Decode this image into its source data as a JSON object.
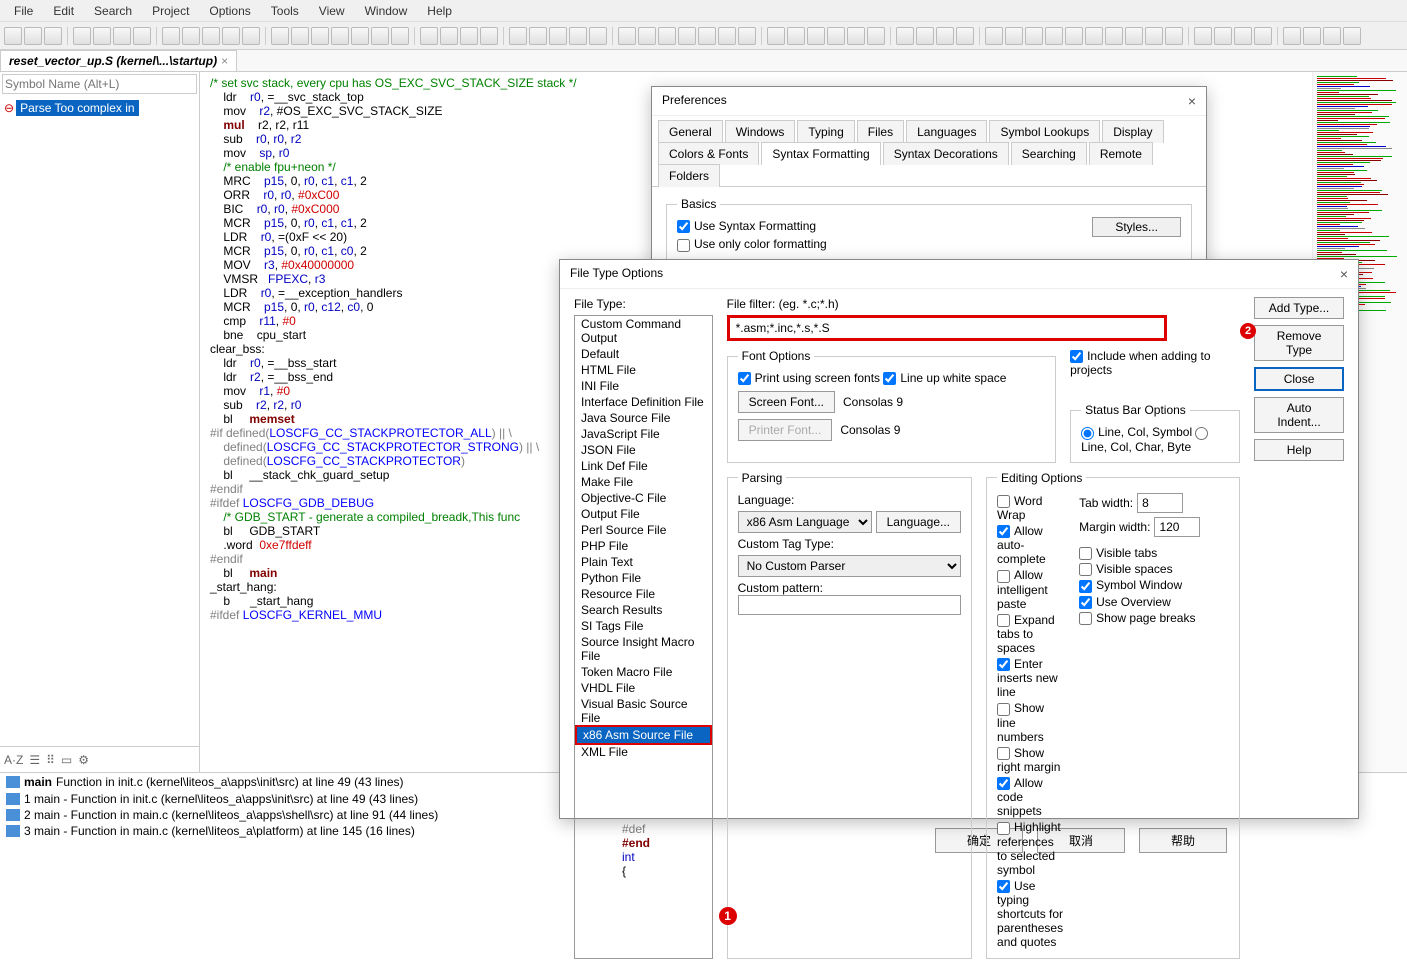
{
  "menu": [
    "File",
    "Edit",
    "Search",
    "Project",
    "Options",
    "Tools",
    "View",
    "Window",
    "Help"
  ],
  "tab": {
    "label": "reset_vector_up.S (kernel\\...\\startup)"
  },
  "sidebar": {
    "placeholder": "Symbol Name (Alt+L)",
    "item": "Parse Too complex in"
  },
  "code": [
    {
      "t": "c",
      "v": "/* set svc stack, every cpu has OS_EXC_SVC_STACK_SIZE stack */"
    },
    {
      "t": "",
      "v": "    ldr    r0, =__svc_stack_top"
    },
    {
      "t": "",
      "v": "    mov    r2, #OS_EXC_SVC_STACK_SIZE"
    },
    {
      "t": "kw",
      "v": "    mul    r2, r2, r11"
    },
    {
      "t": "",
      "v": "    sub    r0, r0, r2"
    },
    {
      "t": "",
      "v": "    mov    sp, r0"
    },
    {
      "t": "",
      "v": ""
    },
    {
      "t": "c",
      "v": "    /* enable fpu+neon */"
    },
    {
      "t": "",
      "v": "    MRC    p15, 0, r0, c1, c1, 2"
    },
    {
      "t": "",
      "v": "    ORR    r0, r0, #0xC00"
    },
    {
      "t": "",
      "v": "    BIC    r0, r0, #0xC000"
    },
    {
      "t": "",
      "v": "    MCR    p15, 0, r0, c1, c1, 2"
    },
    {
      "t": "",
      "v": ""
    },
    {
      "t": "",
      "v": "    LDR    r0, =(0xF << 20)"
    },
    {
      "t": "",
      "v": "    MCR    p15, 0, r0, c1, c0, 2"
    },
    {
      "t": "",
      "v": ""
    },
    {
      "t": "",
      "v": "    MOV    r3, #0x40000000"
    },
    {
      "t": "",
      "v": "    VMSR   FPEXC, r3"
    },
    {
      "t": "",
      "v": ""
    },
    {
      "t": "",
      "v": "    LDR    r0, =__exception_handlers"
    },
    {
      "t": "",
      "v": "    MCR    p15, 0, r0, c12, c0, 0"
    },
    {
      "t": "",
      "v": ""
    },
    {
      "t": "",
      "v": "    cmp    r11, #0"
    },
    {
      "t": "",
      "v": "    bne    cpu_start"
    },
    {
      "t": "",
      "v": ""
    },
    {
      "t": "l",
      "v": "clear_bss:"
    },
    {
      "t": "",
      "v": "    ldr    r0, =__bss_start"
    },
    {
      "t": "",
      "v": "    ldr    r2, =__bss_end"
    },
    {
      "t": "",
      "v": "    mov    r1, #0"
    },
    {
      "t": "",
      "v": "    sub    r2, r2, r0"
    },
    {
      "t": "kw",
      "v": "    bl     memset"
    },
    {
      "t": "",
      "v": ""
    },
    {
      "t": "p",
      "v": "#if defined(LOSCFG_CC_STACKPROTECTOR_ALL) || \\"
    },
    {
      "t": "p",
      "v": "    defined(LOSCFG_CC_STACKPROTECTOR_STRONG) || \\"
    },
    {
      "t": "p",
      "v": "    defined(LOSCFG_CC_STACKPROTECTOR)"
    },
    {
      "t": "",
      "v": "    bl     __stack_chk_guard_setup"
    },
    {
      "t": "p",
      "v": "#endif"
    },
    {
      "t": "",
      "v": ""
    },
    {
      "t": "p",
      "v": "#ifdef LOSCFG_GDB_DEBUG"
    },
    {
      "t": "c",
      "v": "    /* GDB_START - generate a compiled_breadk,This func"
    },
    {
      "t": "",
      "v": "    bl     GDB_START"
    },
    {
      "t": "n",
      "v": "    .word  0xe7ffdeff"
    },
    {
      "t": "p",
      "v": "#endif"
    },
    {
      "t": "",
      "v": ""
    },
    {
      "t": "kw",
      "v": "    bl     main"
    },
    {
      "t": "",
      "v": ""
    },
    {
      "t": "l",
      "v": "_start_hang:"
    },
    {
      "t": "",
      "v": "    b      _start_hang"
    },
    {
      "t": "",
      "v": ""
    },
    {
      "t": "p",
      "v": "#ifdef LOSCFG_KERNEL_MMU"
    }
  ],
  "bottom": {
    "header_fn": "main",
    "header_rest": "Function in init.c (kernel\\liteos_a\\apps\\init\\src) at line 49 (43 lines)",
    "rows": [
      "1 main - Function in init.c (kernel\\liteos_a\\apps\\init\\src) at line 49 (43 lines)",
      "2 main - Function in main.c (kernel\\liteos_a\\apps\\shell\\src) at line 91 (44 lines)",
      "3 main - Function in main.c (kernel\\liteos_a\\platform) at line 145 (16 lines)"
    ]
  },
  "prefs": {
    "title": "Preferences",
    "tabs_top": [
      "General",
      "Windows",
      "Typing",
      "Files",
      "Languages",
      "Symbol Lookups",
      "Display"
    ],
    "tabs_bot": [
      "Colors & Fonts",
      "Syntax Formatting",
      "Syntax Decorations",
      "Searching",
      "Remote",
      "Folders"
    ],
    "active": "Syntax Formatting",
    "basics": "Basics",
    "use_syntax": "Use Syntax Formatting",
    "use_color": "Use only color formatting",
    "styles": "Styles..."
  },
  "ftypes": {
    "title": "File Type Options",
    "filetype_label": "File Type:",
    "filter_label": "File filter: (eg. *.c;*.h)",
    "filter_value": "*.asm;*.inc,*.s,*.S",
    "list": [
      "Custom Command Output",
      "Default",
      "HTML File",
      "INI File",
      "Interface Definition File",
      "Java Source File",
      "JavaScript File",
      "JSON File",
      "Link Def File",
      "Make File",
      "Objective-C File",
      "Output File",
      "Perl Source File",
      "PHP File",
      "Plain Text",
      "Python File",
      "Resource File",
      "Search Results",
      "SI Tags File",
      "Source Insight Macro File",
      "Token Macro File",
      "VHDL File",
      "Visual Basic Source File",
      "x86 Asm Source File",
      "XML File"
    ],
    "selected": "x86 Asm Source File",
    "buttons": {
      "add": "Add Type...",
      "remove": "Remove Type",
      "close": "Close",
      "auto": "Auto Indent...",
      "help": "Help"
    },
    "include": "Include when adding to projects",
    "font": {
      "legend": "Font Options",
      "print": "Print using screen fonts",
      "lineup": "Line up white space",
      "screen": "Screen Font...",
      "printer": "Printer Font...",
      "sample": "Consolas 9"
    },
    "status": {
      "legend": "Status Bar Options",
      "opt1": "Line, Col, Symbol",
      "opt2": "Line, Col, Char, Byte"
    },
    "parsing": {
      "legend": "Parsing",
      "lang_label": "Language:",
      "lang": "x86 Asm Language",
      "lang_btn": "Language...",
      "custom_label": "Custom Tag Type:",
      "custom": "No Custom Parser",
      "pattern_label": "Custom pattern:"
    },
    "edit": {
      "legend": "Editing Options",
      "a": [
        "Word Wrap",
        "Allow auto-complete",
        "Allow intelligent paste",
        "Expand tabs to spaces",
        "Enter inserts new line",
        "Show line numbers",
        "Show right margin",
        "Allow code snippets",
        "Highlight references to selected symbol",
        "Use typing shortcuts for parentheses and quotes"
      ],
      "b": [
        "Visible tabs",
        "Visible spaces",
        "Symbol Window",
        "Use Overview",
        "Show page breaks"
      ],
      "tab_label": "Tab width:",
      "tab": "8",
      "margin_label": "Margin width:",
      "margin": "120"
    },
    "dlg_buttons": [
      "确定",
      "取消",
      "帮助"
    ]
  },
  "snippet": [
    "#def",
    "#end",
    "int ",
    "{"
  ]
}
